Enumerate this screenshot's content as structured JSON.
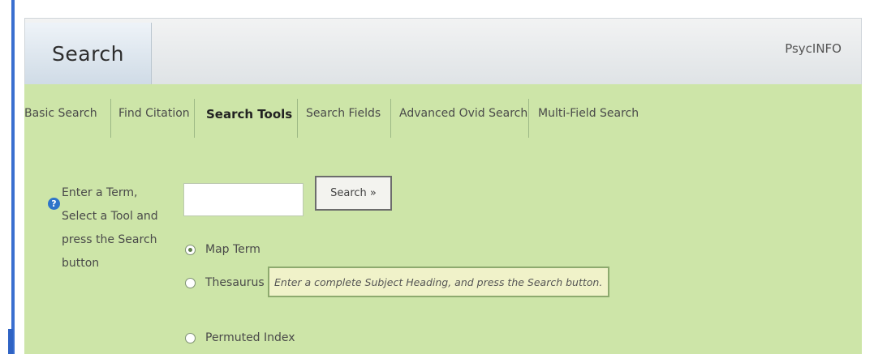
{
  "header": {
    "active_tab": "Search",
    "database": "PsycINFO"
  },
  "nav": {
    "tabs": [
      {
        "label": "Basic Search"
      },
      {
        "label": "Find Citation"
      },
      {
        "label": "Search Tools"
      },
      {
        "label": "Search Fields"
      },
      {
        "label": "Advanced Ovid Search"
      },
      {
        "label": "Multi-Field Search"
      }
    ],
    "active_index": 2
  },
  "form": {
    "help_icon": "?",
    "instructions": "Enter a Term, Select a Tool and press the Search button",
    "term_value": "",
    "search_button": "Search »",
    "options": [
      {
        "label": "Map Term",
        "checked": true
      },
      {
        "label": "Thesaurus",
        "checked": false
      },
      {
        "label": "Permuted Index",
        "checked": false
      }
    ],
    "hint": "Enter a complete Subject Heading, and press the Search button."
  },
  "colors": {
    "accent_blue": "#3a6fd0",
    "panel_green": "#cde5a8"
  }
}
